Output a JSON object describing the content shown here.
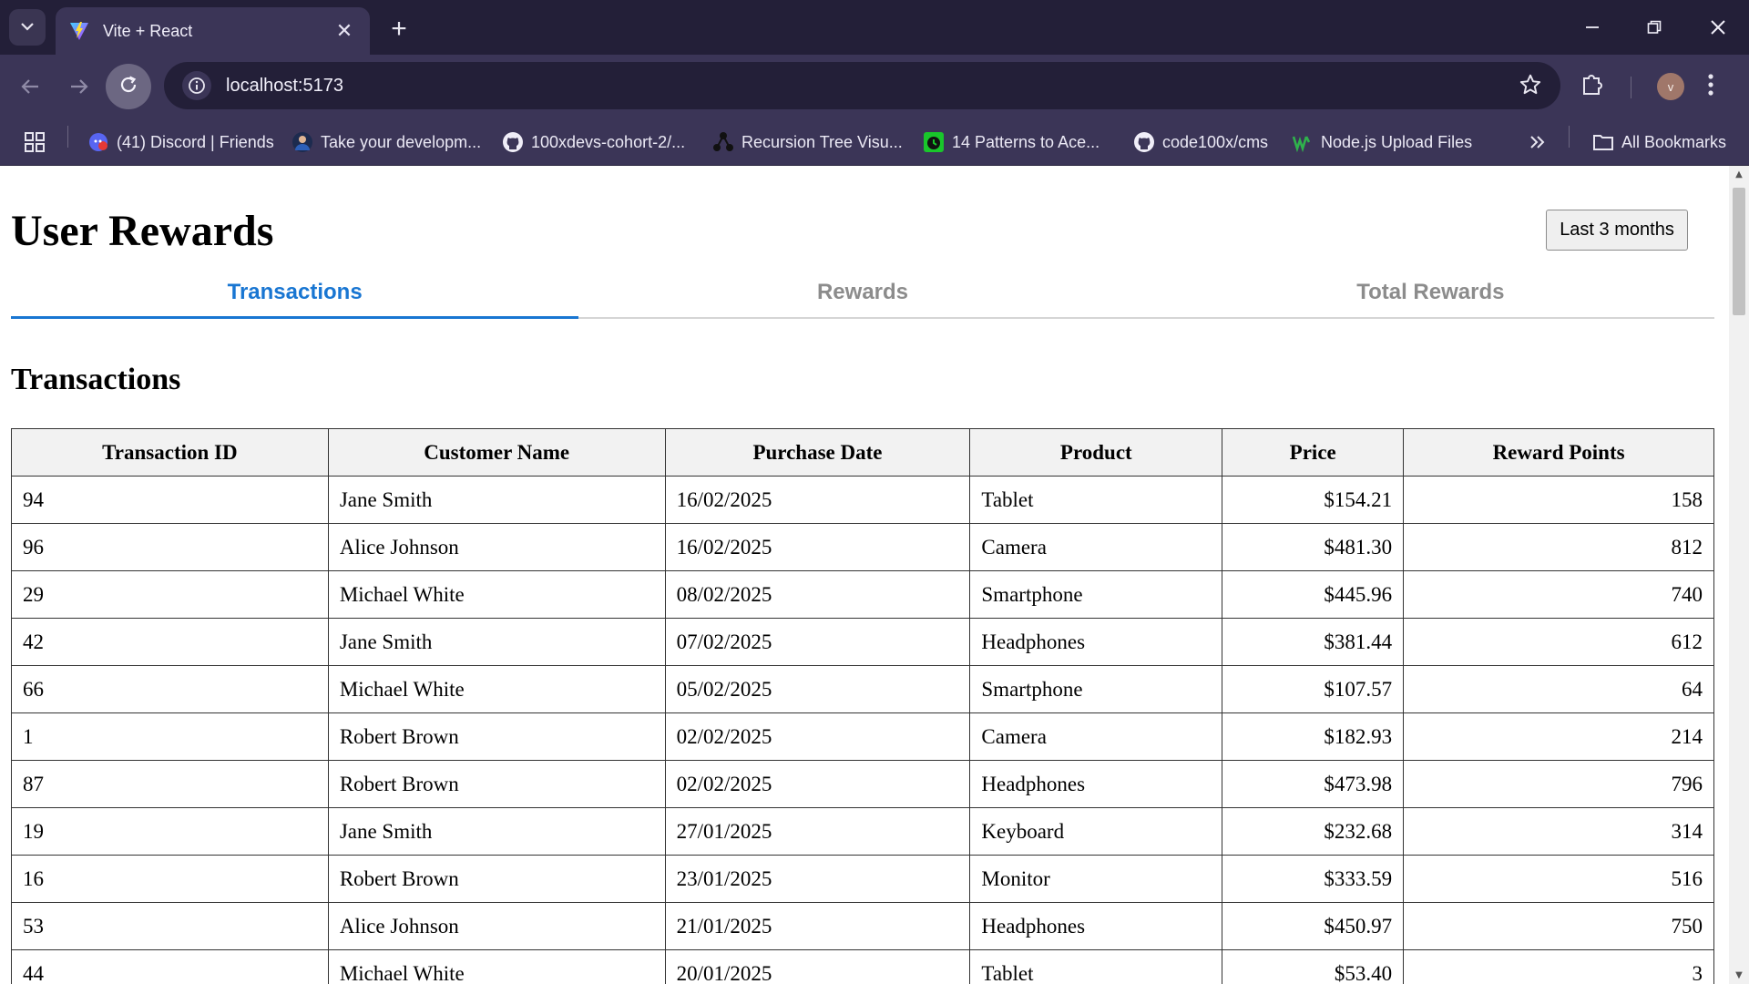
{
  "browser": {
    "tab_title": "Vite + React",
    "url": "localhost:5173",
    "profile_initial": "v",
    "bookmarks": [
      {
        "label": "(41) Discord | Friends",
        "icon": "discord-icon"
      },
      {
        "label": "Take your developm...",
        "icon": "profile-icon"
      },
      {
        "label": "100xdevs-cohort-2/...",
        "icon": "github-icon"
      },
      {
        "label": "Recursion Tree Visu...",
        "icon": "tree-icon"
      },
      {
        "label": "14 Patterns to Ace...",
        "icon": "clock-icon"
      },
      {
        "label": "code100x/cms",
        "icon": "github-icon"
      },
      {
        "label": "Node.js Upload Files",
        "icon": "w-icon"
      }
    ],
    "all_bookmarks": "All Bookmarks"
  },
  "page": {
    "title": "User Rewards",
    "range_button": "Last 3 months",
    "tabs": [
      "Transactions",
      "Rewards",
      "Total Rewards"
    ],
    "active_tab": "Transactions",
    "section_title": "Transactions"
  },
  "table": {
    "headers": [
      "Transaction ID",
      "Customer Name",
      "Purchase Date",
      "Product",
      "Price",
      "Reward Points"
    ],
    "rows": [
      [
        "94",
        "Jane Smith",
        "16/02/2025",
        "Tablet",
        "$154.21",
        "158"
      ],
      [
        "96",
        "Alice Johnson",
        "16/02/2025",
        "Camera",
        "$481.30",
        "812"
      ],
      [
        "29",
        "Michael White",
        "08/02/2025",
        "Smartphone",
        "$445.96",
        "740"
      ],
      [
        "42",
        "Jane Smith",
        "07/02/2025",
        "Headphones",
        "$381.44",
        "612"
      ],
      [
        "66",
        "Michael White",
        "05/02/2025",
        "Smartphone",
        "$107.57",
        "64"
      ],
      [
        "1",
        "Robert Brown",
        "02/02/2025",
        "Camera",
        "$182.93",
        "214"
      ],
      [
        "87",
        "Robert Brown",
        "02/02/2025",
        "Headphones",
        "$473.98",
        "796"
      ],
      [
        "19",
        "Jane Smith",
        "27/01/2025",
        "Keyboard",
        "$232.68",
        "314"
      ],
      [
        "16",
        "Robert Brown",
        "23/01/2025",
        "Monitor",
        "$333.59",
        "516"
      ],
      [
        "53",
        "Alice Johnson",
        "21/01/2025",
        "Headphones",
        "$450.97",
        "750"
      ],
      [
        "44",
        "Michael White",
        "20/01/2025",
        "Tablet",
        "$53.40",
        "3"
      ]
    ]
  },
  "colors": {
    "accent": "#1976d2",
    "chrome_dark": "#231f38",
    "chrome": "#3b3557"
  }
}
